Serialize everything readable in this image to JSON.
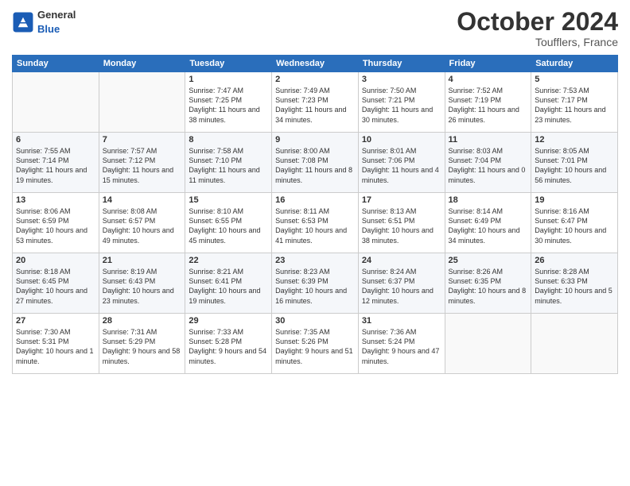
{
  "logo": {
    "general": "General",
    "blue": "Blue"
  },
  "title": "October 2024",
  "location": "Toufflers, France",
  "days_header": [
    "Sunday",
    "Monday",
    "Tuesday",
    "Wednesday",
    "Thursday",
    "Friday",
    "Saturday"
  ],
  "weeks": [
    [
      {
        "day": "",
        "sunrise": "",
        "sunset": "",
        "daylight": ""
      },
      {
        "day": "",
        "sunrise": "",
        "sunset": "",
        "daylight": ""
      },
      {
        "day": "1",
        "sunrise": "Sunrise: 7:47 AM",
        "sunset": "Sunset: 7:25 PM",
        "daylight": "Daylight: 11 hours and 38 minutes."
      },
      {
        "day": "2",
        "sunrise": "Sunrise: 7:49 AM",
        "sunset": "Sunset: 7:23 PM",
        "daylight": "Daylight: 11 hours and 34 minutes."
      },
      {
        "day": "3",
        "sunrise": "Sunrise: 7:50 AM",
        "sunset": "Sunset: 7:21 PM",
        "daylight": "Daylight: 11 hours and 30 minutes."
      },
      {
        "day": "4",
        "sunrise": "Sunrise: 7:52 AM",
        "sunset": "Sunset: 7:19 PM",
        "daylight": "Daylight: 11 hours and 26 minutes."
      },
      {
        "day": "5",
        "sunrise": "Sunrise: 7:53 AM",
        "sunset": "Sunset: 7:17 PM",
        "daylight": "Daylight: 11 hours and 23 minutes."
      }
    ],
    [
      {
        "day": "6",
        "sunrise": "Sunrise: 7:55 AM",
        "sunset": "Sunset: 7:14 PM",
        "daylight": "Daylight: 11 hours and 19 minutes."
      },
      {
        "day": "7",
        "sunrise": "Sunrise: 7:57 AM",
        "sunset": "Sunset: 7:12 PM",
        "daylight": "Daylight: 11 hours and 15 minutes."
      },
      {
        "day": "8",
        "sunrise": "Sunrise: 7:58 AM",
        "sunset": "Sunset: 7:10 PM",
        "daylight": "Daylight: 11 hours and 11 minutes."
      },
      {
        "day": "9",
        "sunrise": "Sunrise: 8:00 AM",
        "sunset": "Sunset: 7:08 PM",
        "daylight": "Daylight: 11 hours and 8 minutes."
      },
      {
        "day": "10",
        "sunrise": "Sunrise: 8:01 AM",
        "sunset": "Sunset: 7:06 PM",
        "daylight": "Daylight: 11 hours and 4 minutes."
      },
      {
        "day": "11",
        "sunrise": "Sunrise: 8:03 AM",
        "sunset": "Sunset: 7:04 PM",
        "daylight": "Daylight: 11 hours and 0 minutes."
      },
      {
        "day": "12",
        "sunrise": "Sunrise: 8:05 AM",
        "sunset": "Sunset: 7:01 PM",
        "daylight": "Daylight: 10 hours and 56 minutes."
      }
    ],
    [
      {
        "day": "13",
        "sunrise": "Sunrise: 8:06 AM",
        "sunset": "Sunset: 6:59 PM",
        "daylight": "Daylight: 10 hours and 53 minutes."
      },
      {
        "day": "14",
        "sunrise": "Sunrise: 8:08 AM",
        "sunset": "Sunset: 6:57 PM",
        "daylight": "Daylight: 10 hours and 49 minutes."
      },
      {
        "day": "15",
        "sunrise": "Sunrise: 8:10 AM",
        "sunset": "Sunset: 6:55 PM",
        "daylight": "Daylight: 10 hours and 45 minutes."
      },
      {
        "day": "16",
        "sunrise": "Sunrise: 8:11 AM",
        "sunset": "Sunset: 6:53 PM",
        "daylight": "Daylight: 10 hours and 41 minutes."
      },
      {
        "day": "17",
        "sunrise": "Sunrise: 8:13 AM",
        "sunset": "Sunset: 6:51 PM",
        "daylight": "Daylight: 10 hours and 38 minutes."
      },
      {
        "day": "18",
        "sunrise": "Sunrise: 8:14 AM",
        "sunset": "Sunset: 6:49 PM",
        "daylight": "Daylight: 10 hours and 34 minutes."
      },
      {
        "day": "19",
        "sunrise": "Sunrise: 8:16 AM",
        "sunset": "Sunset: 6:47 PM",
        "daylight": "Daylight: 10 hours and 30 minutes."
      }
    ],
    [
      {
        "day": "20",
        "sunrise": "Sunrise: 8:18 AM",
        "sunset": "Sunset: 6:45 PM",
        "daylight": "Daylight: 10 hours and 27 minutes."
      },
      {
        "day": "21",
        "sunrise": "Sunrise: 8:19 AM",
        "sunset": "Sunset: 6:43 PM",
        "daylight": "Daylight: 10 hours and 23 minutes."
      },
      {
        "day": "22",
        "sunrise": "Sunrise: 8:21 AM",
        "sunset": "Sunset: 6:41 PM",
        "daylight": "Daylight: 10 hours and 19 minutes."
      },
      {
        "day": "23",
        "sunrise": "Sunrise: 8:23 AM",
        "sunset": "Sunset: 6:39 PM",
        "daylight": "Daylight: 10 hours and 16 minutes."
      },
      {
        "day": "24",
        "sunrise": "Sunrise: 8:24 AM",
        "sunset": "Sunset: 6:37 PM",
        "daylight": "Daylight: 10 hours and 12 minutes."
      },
      {
        "day": "25",
        "sunrise": "Sunrise: 8:26 AM",
        "sunset": "Sunset: 6:35 PM",
        "daylight": "Daylight: 10 hours and 8 minutes."
      },
      {
        "day": "26",
        "sunrise": "Sunrise: 8:28 AM",
        "sunset": "Sunset: 6:33 PM",
        "daylight": "Daylight: 10 hours and 5 minutes."
      }
    ],
    [
      {
        "day": "27",
        "sunrise": "Sunrise: 7:30 AM",
        "sunset": "Sunset: 5:31 PM",
        "daylight": "Daylight: 10 hours and 1 minute."
      },
      {
        "day": "28",
        "sunrise": "Sunrise: 7:31 AM",
        "sunset": "Sunset: 5:29 PM",
        "daylight": "Daylight: 9 hours and 58 minutes."
      },
      {
        "day": "29",
        "sunrise": "Sunrise: 7:33 AM",
        "sunset": "Sunset: 5:28 PM",
        "daylight": "Daylight: 9 hours and 54 minutes."
      },
      {
        "day": "30",
        "sunrise": "Sunrise: 7:35 AM",
        "sunset": "Sunset: 5:26 PM",
        "daylight": "Daylight: 9 hours and 51 minutes."
      },
      {
        "day": "31",
        "sunrise": "Sunrise: 7:36 AM",
        "sunset": "Sunset: 5:24 PM",
        "daylight": "Daylight: 9 hours and 47 minutes."
      },
      {
        "day": "",
        "sunrise": "",
        "sunset": "",
        "daylight": ""
      },
      {
        "day": "",
        "sunrise": "",
        "sunset": "",
        "daylight": ""
      }
    ]
  ]
}
